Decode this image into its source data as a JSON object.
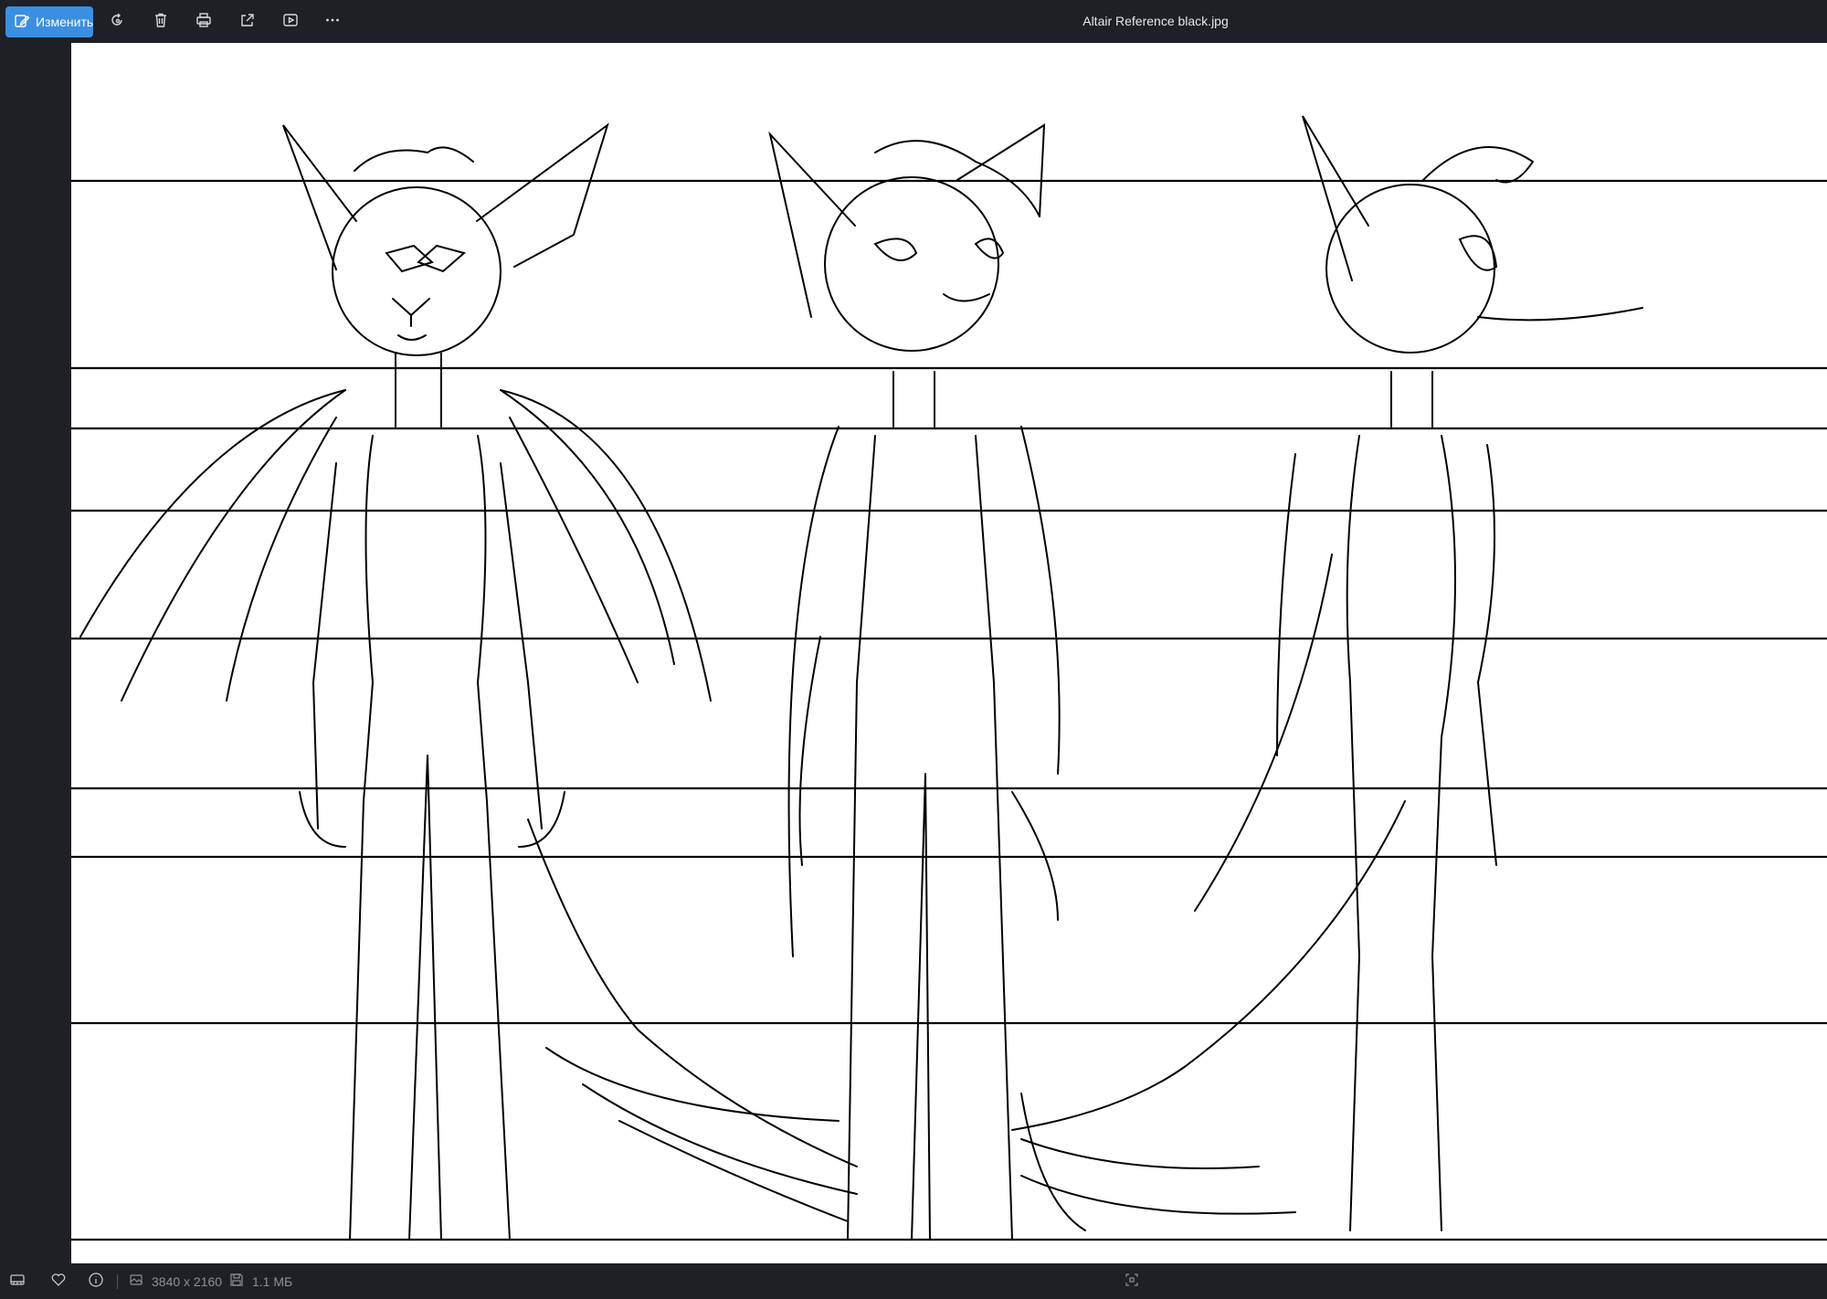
{
  "toolbar": {
    "edit_label": "Изменить",
    "buttons": [
      "rotate-icon",
      "delete-icon",
      "print-icon",
      "share-icon",
      "slideshow-icon",
      "more-icon"
    ]
  },
  "window": {
    "title": "Altair Reference black.jpg"
  },
  "statusbar": {
    "dimensions": "3840 x 2160",
    "file_size": "1.1 МБ"
  },
  "colors": {
    "accent": "#3b8fe0",
    "chrome": "#1f2026",
    "canvas": "#ffffff",
    "status_text": "#8f9096"
  }
}
